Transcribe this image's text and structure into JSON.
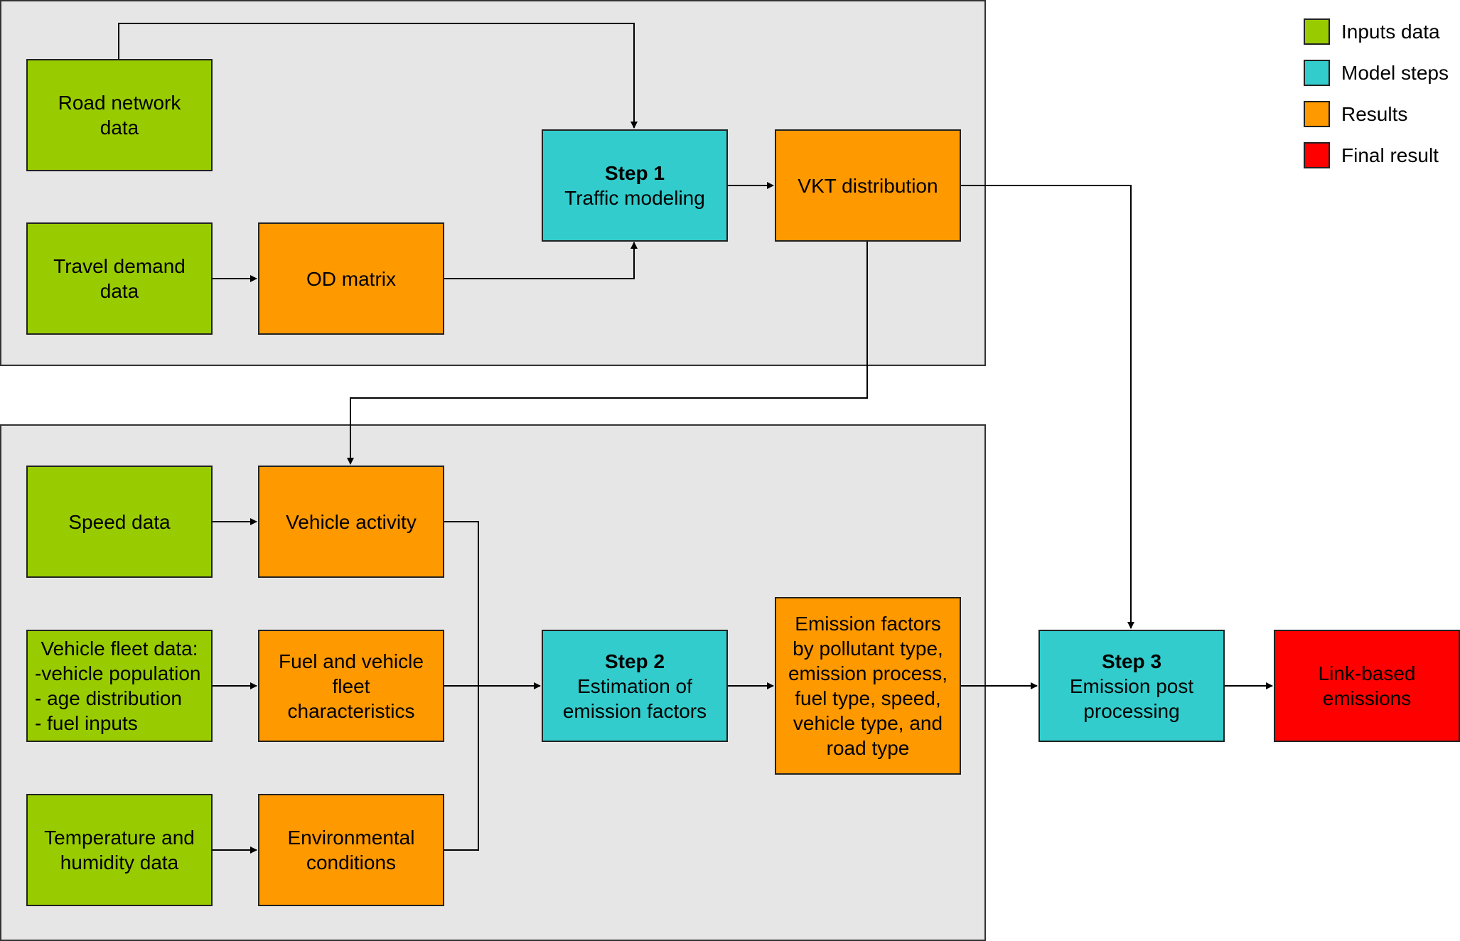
{
  "legend": [
    {
      "label": "Inputs data",
      "color": "#99cc00"
    },
    {
      "label": "Model steps",
      "color": "#33cccc"
    },
    {
      "label": "Results",
      "color": "#ff9900"
    },
    {
      "label": "Final result",
      "color": "#ff0000"
    }
  ],
  "nodes": {
    "road_network": {
      "lines": [
        "Road network",
        "data"
      ]
    },
    "travel_demand": {
      "lines": [
        "Travel demand",
        "data"
      ]
    },
    "od_matrix": {
      "lines": [
        "OD matrix"
      ]
    },
    "step1": {
      "title": "Step 1",
      "lines": [
        "Traffic modeling"
      ]
    },
    "vkt": {
      "lines": [
        "VKT distribution"
      ]
    },
    "speed_data": {
      "lines": [
        "Speed data"
      ]
    },
    "vehicle_activity": {
      "lines": [
        "Vehicle activity"
      ]
    },
    "fleet_data": {
      "lines": [
        "Vehicle fleet data:",
        "-vehicle population",
        "- age distribution",
        "- fuel inputs"
      ]
    },
    "fuel_fleet": {
      "lines": [
        "Fuel and vehicle",
        "fleet",
        "characteristics"
      ]
    },
    "temp_humidity": {
      "lines": [
        "Temperature and",
        "humidity data"
      ]
    },
    "env_conditions": {
      "lines": [
        "Environmental",
        "conditions"
      ]
    },
    "step2": {
      "title": "Step 2",
      "lines": [
        "Estimation of",
        "emission factors"
      ]
    },
    "emission_factors": {
      "lines": [
        "Emission factors",
        "by pollutant type,",
        "emission process,",
        "fuel type, speed,",
        "vehicle type, and",
        "road type"
      ]
    },
    "step3": {
      "title": "Step 3",
      "lines": [
        "Emission post",
        "processing"
      ]
    },
    "link_emissions": {
      "lines": [
        "Link-based",
        "emissions"
      ]
    }
  }
}
